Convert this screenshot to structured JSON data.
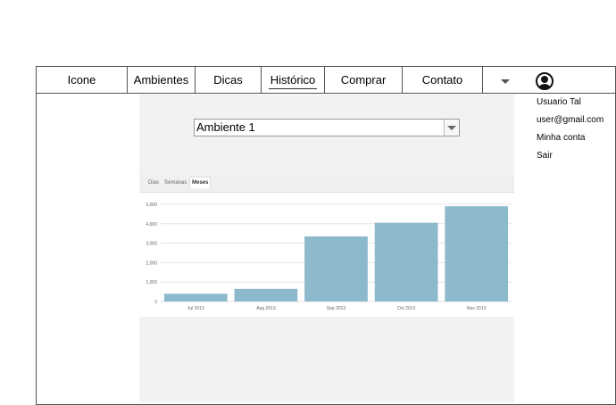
{
  "nav": {
    "items": [
      "Icone",
      "Ambientes",
      "Dicas",
      "Histórico",
      "Comprar",
      "Contato"
    ],
    "active_item": "Histórico"
  },
  "user_menu": {
    "name": "Usuario Tal",
    "email": "user@gmail.com",
    "account": "Minha conta",
    "logout": "Sair"
  },
  "environment_select": {
    "value": "Ambiente 1"
  },
  "chart_tabs": {
    "items": [
      "Dias",
      "Semanas",
      "Meses"
    ],
    "active": "Meses"
  },
  "chart_data": {
    "type": "bar",
    "categories": [
      "Jul 2013",
      "Aug 2013",
      "Sep 2013",
      "Oct 2013",
      "Nov 2013"
    ],
    "values": [
      400,
      650,
      3350,
      4050,
      4900
    ],
    "ylim": [
      0,
      5000
    ],
    "yticks": [
      "0",
      "1,000",
      "2,000",
      "3,000",
      "4,000",
      "5,000"
    ],
    "grid": true,
    "bar_color": "#8db9cc"
  }
}
